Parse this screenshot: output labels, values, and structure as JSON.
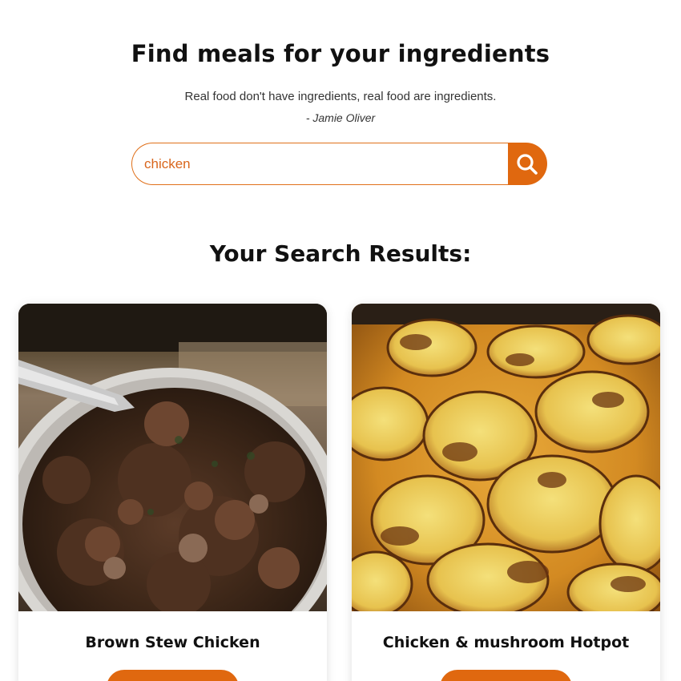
{
  "header": {
    "title": "Find meals for your ingredients",
    "quote": "Real food don't have ingredients, real food are ingredients.",
    "author": "- Jamie Oliver"
  },
  "search": {
    "value": "chicken",
    "button_icon": "search-icon"
  },
  "results": {
    "title": "Your Search Results:",
    "meals": [
      {
        "name": "Brown Stew Chicken",
        "image": "brown-stew-chicken-photo"
      },
      {
        "name": "Chicken & mushroom Hotpot",
        "image": "chicken-mushroom-hotpot-photo"
      }
    ]
  },
  "colors": {
    "accent": "#e0680f",
    "text": "#111111"
  }
}
